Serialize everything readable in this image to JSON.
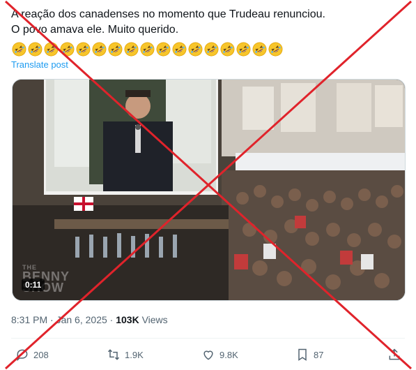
{
  "post": {
    "line1": "A reação dos canadenses no momento que Trudeau renunciou.",
    "line2": "O povo amava ele. Muito querido.",
    "emoji_count": 17,
    "emoji_name": "rolling-on-floor-laughing-emoji",
    "translate_label": "Translate post"
  },
  "video": {
    "duration": "0:11",
    "watermark_line1": "THE",
    "watermark_line2": "BENNY",
    "watermark_line3": "SHOW"
  },
  "meta": {
    "time": "8:31 PM",
    "separator": "·",
    "date": "Jan 6, 2025",
    "views_count": "103K",
    "views_label": "Views"
  },
  "actions": {
    "replies": "208",
    "reposts": "1.9K",
    "likes": "9.8K",
    "bookmarks": "87"
  },
  "colors": {
    "accent": "#1d9bf0",
    "overlay_x": "#e0232b",
    "secondary_text": "#536471"
  }
}
